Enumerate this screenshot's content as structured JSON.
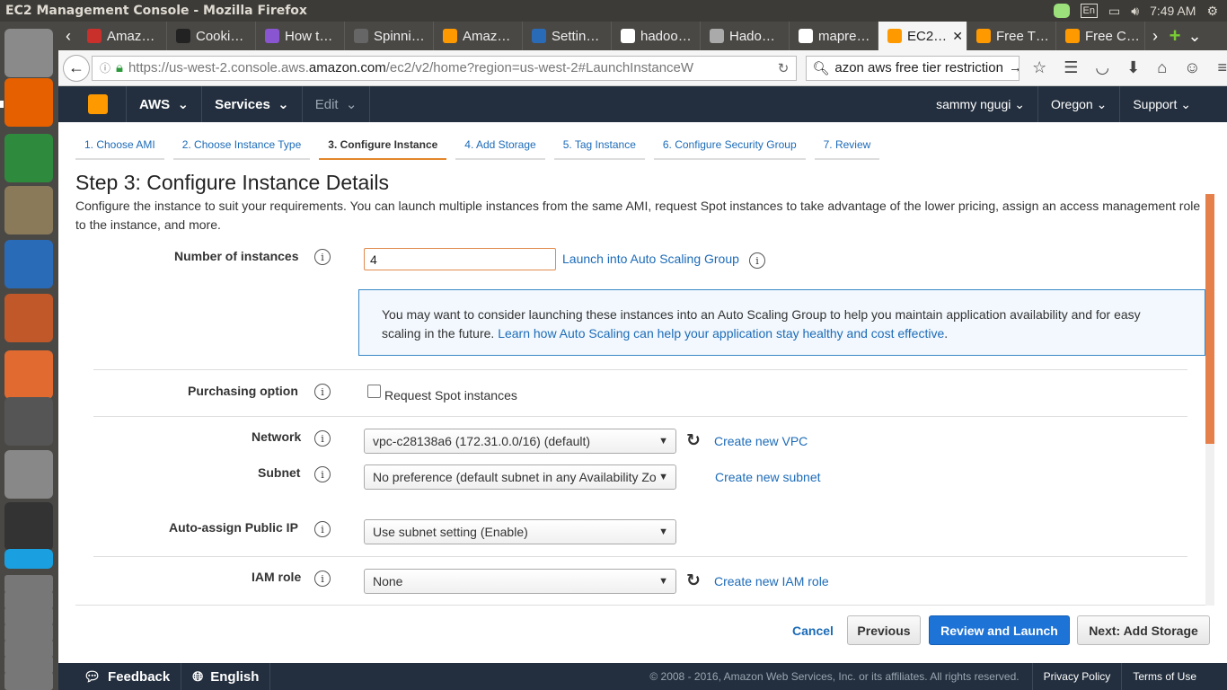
{
  "os": {
    "window_title": "EC2 Management Console - Mozilla Firefox",
    "keyboard": "En",
    "clock": "7:49 AM"
  },
  "launcher": [
    {
      "name": "ubuntu",
      "color": "#8a8a8a"
    },
    {
      "name": "firefox",
      "color": "#e66000"
    },
    {
      "name": "calc",
      "color": "#2e8b3e"
    },
    {
      "name": "files",
      "color": "#8a7a5a"
    },
    {
      "name": "writer",
      "color": "#2a6bb8"
    },
    {
      "name": "impress",
      "color": "#c0582a"
    },
    {
      "name": "software",
      "color": "#e06a30"
    },
    {
      "name": "amazon",
      "color": "#555"
    },
    {
      "name": "settings",
      "color": "#888"
    },
    {
      "name": "terminal",
      "color": "#333"
    },
    {
      "name": "skype",
      "color": "#1aa0e0"
    }
  ],
  "browser": {
    "tabs": [
      {
        "label": "Amaz…",
        "fav": "#c9302c"
      },
      {
        "label": "Cooki…",
        "fav": "#222"
      },
      {
        "label": "How t…",
        "fav": "#8a55d0"
      },
      {
        "label": "Spinni…",
        "fav": "#666"
      },
      {
        "label": "Amaz…",
        "fav": "#f90"
      },
      {
        "label": "Settin…",
        "fav": "#2a6bb8"
      },
      {
        "label": "hadoo…",
        "fav": "#fff"
      },
      {
        "label": "Hado…",
        "fav": "#aaa"
      },
      {
        "label": "mapre…",
        "fav": "#fff"
      },
      {
        "label": "EC2…",
        "fav": "#f90"
      },
      {
        "label": "Free T…",
        "fav": "#f90"
      },
      {
        "label": "Free C…",
        "fav": "#f90"
      }
    ],
    "url_prefix": "https://us-west-2.console.aws.",
    "url_host": "amazon.com",
    "url_path": "/ec2/v2/home?region=us-west-2#LaunchInstanceW",
    "search_value": "azon aws free tier restriction"
  },
  "aws_header": {
    "aws": "AWS",
    "services": "Services",
    "edit": "Edit",
    "user": "sammy ngugi",
    "region": "Oregon",
    "support": "Support"
  },
  "steps": [
    "1. Choose AMI",
    "2. Choose Instance Type",
    "3. Configure Instance",
    "4. Add Storage",
    "5. Tag Instance",
    "6. Configure Security Group",
    "7. Review"
  ],
  "page": {
    "title": "Step 3: Configure Instance Details",
    "intro": "Configure the instance to suit your requirements. You can launch multiple instances from the same AMI, request Spot instances to take advantage of the lower pricing, assign an access management role to the instance, and more."
  },
  "form": {
    "num_instances_label": "Number of instances",
    "num_instances_value": "4",
    "asg_link": "Launch into Auto Scaling Group",
    "note_text": "You may want to consider launching these instances into an Auto Scaling Group to help you maintain application availability and for easy scaling in the future.",
    "note_link": "Learn how Auto Scaling can help your application stay healthy and cost effective",
    "purchasing_label": "Purchasing option",
    "spot_label": "Request Spot instances",
    "network_label": "Network",
    "network_value": "vpc-c28138a6 (172.31.0.0/16) (default)",
    "create_vpc": "Create new VPC",
    "subnet_label": "Subnet",
    "subnet_value": "No preference (default subnet in any Availability Zo",
    "create_subnet": "Create new subnet",
    "public_ip_label": "Auto-assign Public IP",
    "public_ip_value": "Use subnet setting (Enable)",
    "iam_label": "IAM role",
    "iam_value": "None",
    "create_iam": "Create new IAM role"
  },
  "buttons": {
    "cancel": "Cancel",
    "previous": "Previous",
    "review": "Review and Launch",
    "next": "Next: Add Storage"
  },
  "footer": {
    "feedback": "Feedback",
    "english": "English",
    "copyright": "© 2008 - 2016, Amazon Web Services, Inc. or its affiliates. All rights reserved.",
    "privacy": "Privacy Policy",
    "terms": "Terms of Use"
  },
  "colors": {
    "aws_nav": "#232f3e",
    "link": "#1c6bb8",
    "primary_button": "#1e73d6",
    "aws_orange": "#ff9900"
  }
}
